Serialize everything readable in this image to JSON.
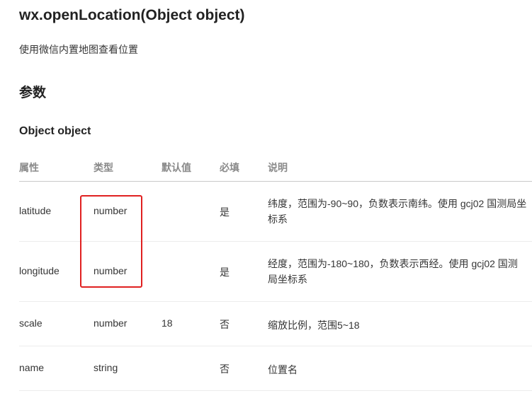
{
  "title": "wx.openLocation(Object object)",
  "description": "使用微信内置地图查看位置",
  "params_heading": "参数",
  "object_heading": "Object object",
  "table": {
    "headers": [
      "属性",
      "类型",
      "默认值",
      "必填",
      "说明"
    ],
    "rows": [
      {
        "name": "latitude",
        "type": "number",
        "default": "",
        "required": "是",
        "desc": "纬度，范围为-90~90，负数表示南纬。使用 gcj02 国测局坐标系"
      },
      {
        "name": "longitude",
        "type": "number",
        "default": "",
        "required": "是",
        "desc": "经度，范围为-180~180，负数表示西经。使用 gcj02 国测局坐标系"
      },
      {
        "name": "scale",
        "type": "number",
        "default": "18",
        "required": "否",
        "desc": "缩放比例，范围5~18"
      },
      {
        "name": "name",
        "type": "string",
        "default": "",
        "required": "否",
        "desc": "位置名"
      }
    ]
  },
  "colors": {
    "highlight_box": "#e02020",
    "header_text": "#8a8a8a",
    "body_text": "#353535"
  }
}
